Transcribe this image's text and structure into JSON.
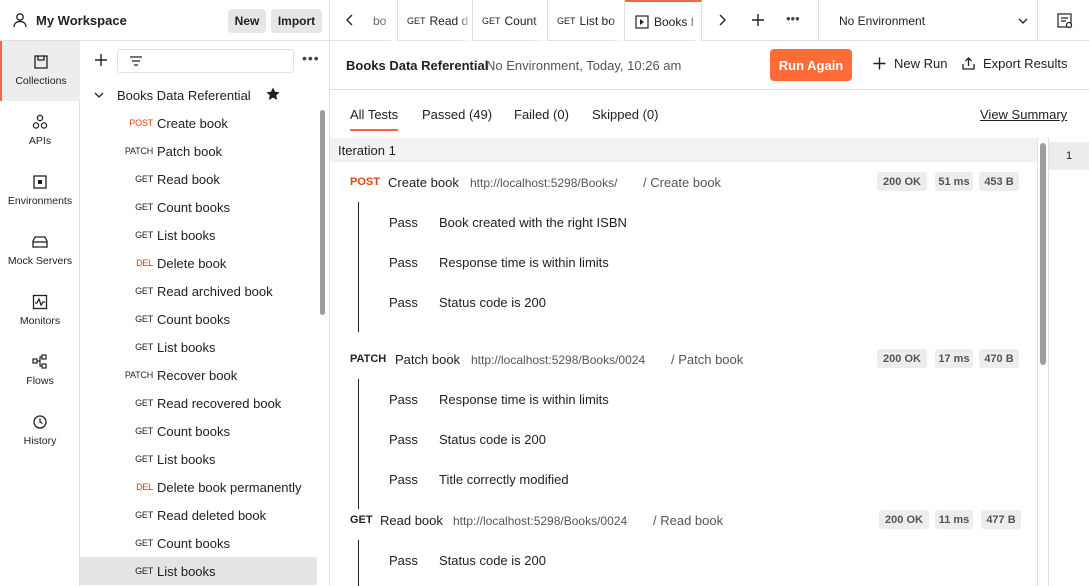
{
  "workspace": {
    "title": "My Workspace",
    "new_label": "New",
    "import_label": "Import"
  },
  "rail": [
    {
      "label": "Collections",
      "icon": "collections-icon"
    },
    {
      "label": "APIs",
      "icon": "apis-icon"
    },
    {
      "label": "Environments",
      "icon": "environments-icon"
    },
    {
      "label": "Mock Servers",
      "icon": "mock-servers-icon"
    },
    {
      "label": "Monitors",
      "icon": "monitors-icon"
    },
    {
      "label": "Flows",
      "icon": "flows-icon"
    },
    {
      "label": "History",
      "icon": "history-icon"
    }
  ],
  "collection": {
    "name": "Books Data Referential",
    "items": [
      {
        "method": "POST",
        "name": "Create book"
      },
      {
        "method": "PATCH",
        "name": "Patch book"
      },
      {
        "method": "GET",
        "name": "Read book"
      },
      {
        "method": "GET",
        "name": "Count books"
      },
      {
        "method": "GET",
        "name": "List books"
      },
      {
        "method": "DEL",
        "name": "Delete book"
      },
      {
        "method": "GET",
        "name": "Read archived book"
      },
      {
        "method": "GET",
        "name": "Count books"
      },
      {
        "method": "GET",
        "name": "List books"
      },
      {
        "method": "PATCH",
        "name": "Recover book"
      },
      {
        "method": "GET",
        "name": "Read recovered book"
      },
      {
        "method": "GET",
        "name": "Count books"
      },
      {
        "method": "GET",
        "name": "List books"
      },
      {
        "method": "DEL",
        "name": "Delete book permanently"
      },
      {
        "method": "GET",
        "name": "Read deleted book"
      },
      {
        "method": "GET",
        "name": "Count books"
      },
      {
        "method": "GET",
        "name": "List books"
      }
    ]
  },
  "tabs": [
    {
      "method": "",
      "label": "bo"
    },
    {
      "method": "GET",
      "label": "Read d"
    },
    {
      "method": "GET",
      "label": "Count"
    },
    {
      "method": "GET",
      "label": "List bo"
    },
    {
      "method": "",
      "label": "Books I"
    }
  ],
  "environment": {
    "value": "No Environment"
  },
  "runner": {
    "title": "Books Data Referential",
    "meta": "No Environment, Today, 10:26 am",
    "run_again": "Run Again",
    "new_run": "New Run",
    "export": "Export Results"
  },
  "filters": {
    "all": "All Tests",
    "passed": "Passed (49)",
    "failed": "Failed (0)",
    "skipped": "Skipped (0)",
    "view_summary": "View Summary"
  },
  "iteration": {
    "label": "Iteration 1",
    "number": "1"
  },
  "requests": [
    {
      "method": "POST",
      "name": "Create book",
      "url": "http://localhost:5298/Books/",
      "folder": "/ Create book",
      "status": "200 OK",
      "time": "51 ms",
      "size": "453 B",
      "tests": [
        {
          "status": "Pass",
          "name": "Book created with the right ISBN"
        },
        {
          "status": "Pass",
          "name": "Response time is within limits"
        },
        {
          "status": "Pass",
          "name": "Status code is 200"
        }
      ]
    },
    {
      "method": "PATCH",
      "name": "Patch book",
      "url": "http://localhost:5298/Books/0024",
      "folder": "/ Patch book",
      "status": "200 OK",
      "time": "17 ms",
      "size": "470 B",
      "tests": [
        {
          "status": "Pass",
          "name": "Response time is within limits"
        },
        {
          "status": "Pass",
          "name": "Status code is 200"
        },
        {
          "status": "Pass",
          "name": "Title correctly modified"
        }
      ]
    },
    {
      "method": "GET",
      "name": "Read book",
      "url": "http://localhost:5298/Books/0024",
      "folder": "/ Read book",
      "status": "200 OK",
      "time": "11 ms",
      "size": "477 B",
      "tests": [
        {
          "status": "Pass",
          "name": "Status code is 200"
        }
      ]
    }
  ]
}
